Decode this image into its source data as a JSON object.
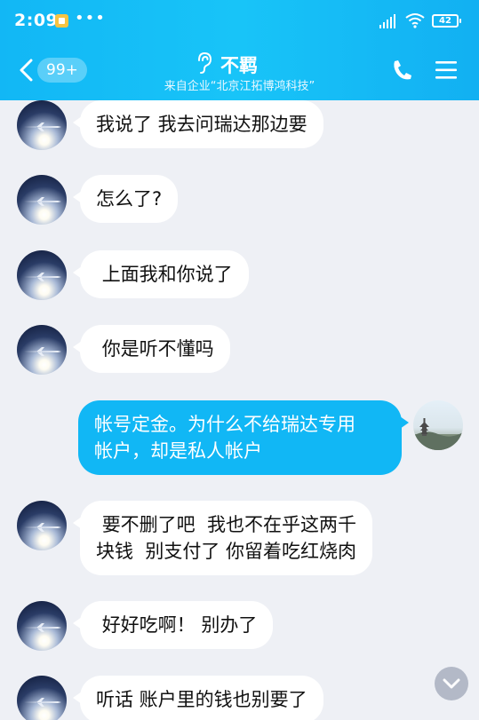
{
  "status_bar": {
    "time": "2:09",
    "more": "•••",
    "battery": "42"
  },
  "header": {
    "unread_count": "99+",
    "title": "不羁",
    "subtitle": "来自企业“北京江拓博鸿科技”"
  },
  "messages": [
    {
      "sender": "other",
      "text": "我说了 我去问瑞达那边要"
    },
    {
      "sender": "other",
      "text": "怎么了?"
    },
    {
      "sender": "other",
      "text": " 上面我和你说了"
    },
    {
      "sender": "other",
      "text": " 你是听不懂吗"
    },
    {
      "sender": "self",
      "text": "帐号定金。为什么不给瑞达专用\n帐户，却是私人帐户"
    },
    {
      "sender": "other",
      "text": " 要不删了吧  我也不在乎这两千\n块钱  别支付了 你留着吃红烧肉"
    },
    {
      "sender": "other",
      "text": " 好好吃啊！ 别办了"
    },
    {
      "sender": "other",
      "text": "听话 账户里的钱也别要了"
    }
  ],
  "colors": {
    "header": "#12b7f5",
    "self_bubble": "#11b7f5",
    "chat_bg": "#eef0f5"
  }
}
